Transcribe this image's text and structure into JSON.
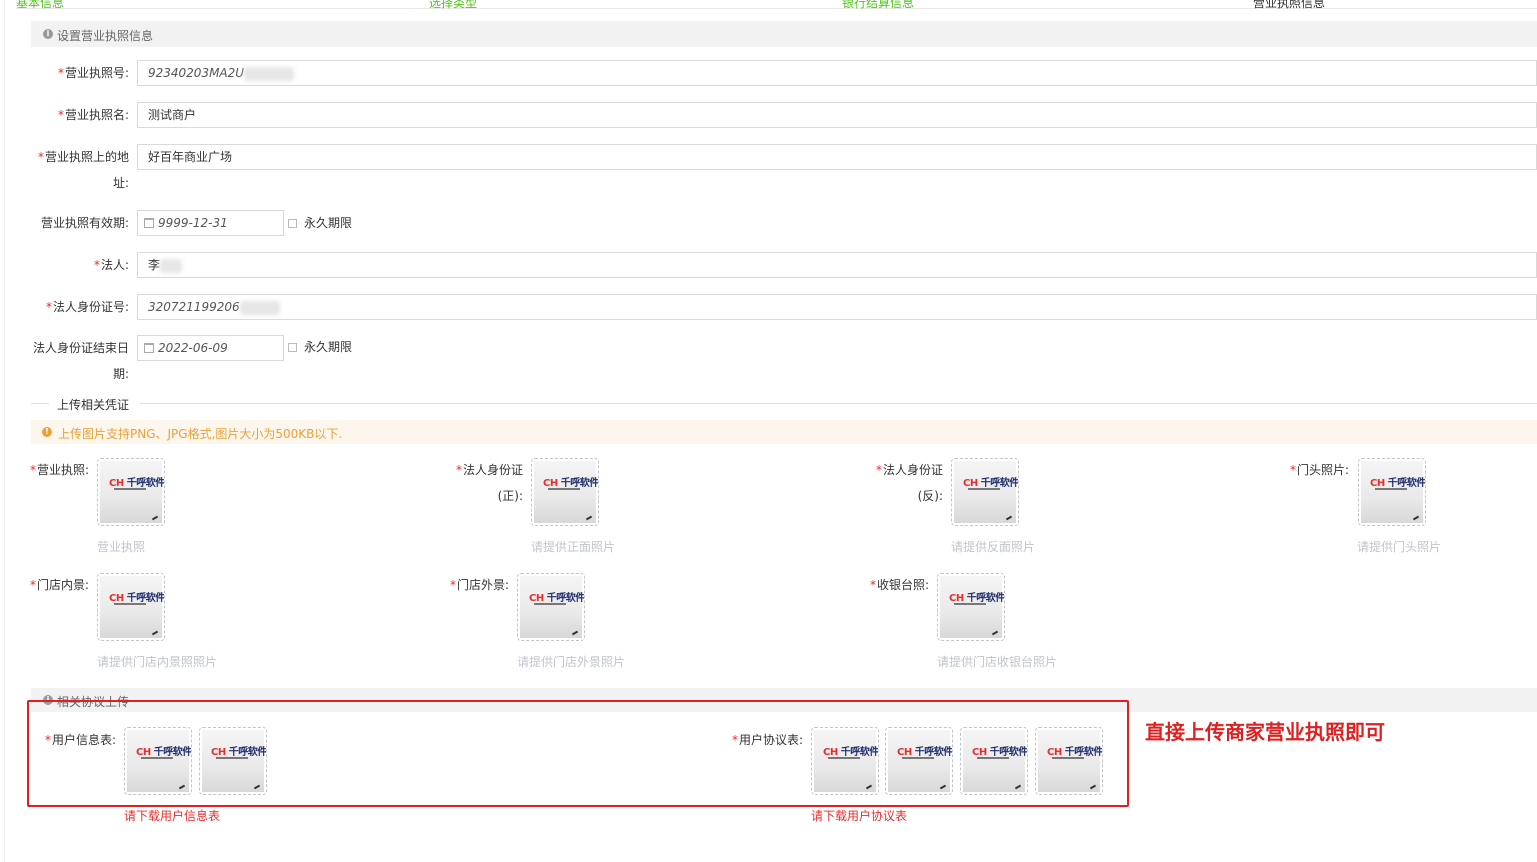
{
  "steps": [
    "基本信息",
    "选择类型",
    "银行结算信息",
    "营业执照信息"
  ],
  "license_section": {
    "title": "设置营业执照信息",
    "license_no": {
      "label": "营业执照号",
      "value": "92340203MA2U"
    },
    "license_name": {
      "label": "营业执照名",
      "value": "测试商户"
    },
    "license_addr": {
      "label": "营业执照上的地址",
      "value": "好百年商业广场"
    },
    "license_valid": {
      "label": "营业执照有效期",
      "value": "9999-12-31",
      "forever": "永久期限"
    },
    "legal_person": {
      "label": "法人",
      "value": "李"
    },
    "legal_id": {
      "label": "法人身份证号",
      "value": "320721199206"
    },
    "legal_id_end": {
      "label": "法人身份证结束日期",
      "value": "2022-06-09",
      "forever": "永久期限"
    }
  },
  "upload_section": {
    "title": "上传相关凭证",
    "tip": "上传图片支持PNG、JPG格式,图片大小为500KB以下.",
    "items": [
      {
        "label": "营业执照",
        "hint": "营业执照"
      },
      {
        "label": "法人身份证(正)",
        "hint": "请提供正面照片"
      },
      {
        "label": "法人身份证(反)",
        "hint": "请提供反面照片"
      },
      {
        "label": "门头照片",
        "hint": "请提供门头照片"
      },
      {
        "label": "门店内景",
        "hint": "请提供门店内景照照片"
      },
      {
        "label": "门店外景",
        "hint": "请提供门店外景照片"
      },
      {
        "label": "收银台照",
        "hint": "请提供门店收银台照片"
      }
    ],
    "logo_text": "千呼软件"
  },
  "agreement_section": {
    "title": "相关协议上传",
    "user_info": {
      "label": "用户信息表",
      "download": "请下载用户信息表"
    },
    "user_agreement": {
      "label": "用户协议表",
      "download": "请下载用户协议表"
    }
  },
  "annotation": "直接上传商家营业执照即可",
  "colors": {
    "required": "#f5222d",
    "warning": "#e6a23c",
    "annotation": "#e02020",
    "step_done": "#52c41a"
  }
}
